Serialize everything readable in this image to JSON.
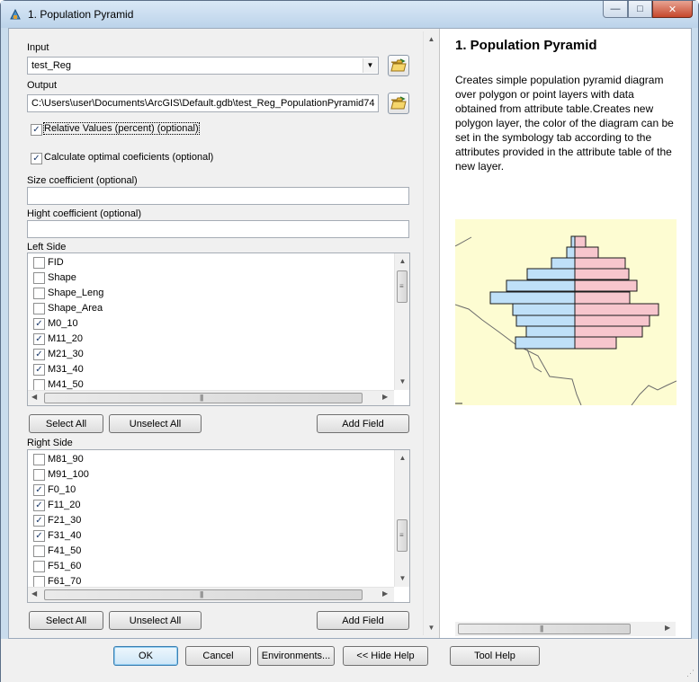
{
  "window": {
    "title": "1. Population Pyramid",
    "controls": {
      "minimize": "—",
      "maximize": "□",
      "close": "✕"
    }
  },
  "form": {
    "input": {
      "label": "Input",
      "value": "test_Reg"
    },
    "output": {
      "label": "Output",
      "value": "C:\\Users\\user\\Documents\\ArcGIS\\Default.gdb\\test_Reg_PopulationPyramid74"
    },
    "relative_values": {
      "label": "Relative Values (percent) (optional)",
      "checked": true
    },
    "calculate_optimal": {
      "label": "Calculate optimal coeficients (optional)",
      "checked": true
    },
    "size_coefficient": {
      "label": "Size coefficient (optional)",
      "value": ""
    },
    "hight_coefficient": {
      "label": "Hight coefficient (optional)",
      "value": ""
    },
    "left_side": {
      "label": "Left Side",
      "items": [
        {
          "label": "FID",
          "checked": false
        },
        {
          "label": "Shape",
          "checked": false
        },
        {
          "label": "Shape_Leng",
          "checked": false
        },
        {
          "label": "Shape_Area",
          "checked": false
        },
        {
          "label": "M0_10",
          "checked": true
        },
        {
          "label": "M11_20",
          "checked": true
        },
        {
          "label": "M21_30",
          "checked": true
        },
        {
          "label": "M31_40",
          "checked": true
        },
        {
          "label": "M41_50",
          "checked": false
        }
      ],
      "select_all": "Select All",
      "unselect_all": "Unselect All",
      "add_field": "Add Field"
    },
    "right_side": {
      "label": "Right Side",
      "items": [
        {
          "label": "M81_90",
          "checked": false
        },
        {
          "label": "M91_100",
          "checked": false
        },
        {
          "label": "F0_10",
          "checked": true
        },
        {
          "label": "F11_20",
          "checked": true
        },
        {
          "label": "F21_30",
          "checked": true
        },
        {
          "label": "F31_40",
          "checked": true
        },
        {
          "label": "F41_50",
          "checked": false
        },
        {
          "label": "F51_60",
          "checked": false
        },
        {
          "label": "F61_70",
          "checked": false
        }
      ],
      "select_all": "Select All",
      "unselect_all": "Unselect All",
      "add_field": "Add Field"
    }
  },
  "help": {
    "title": "1. Population Pyramid",
    "description": "Creates simple population pyramid diagram over polygon or point layers with data obtained from attribute table.Creates new polygon layer, the color of the diagram can be set in the symbology tab according to the attributes provided in the attribute table of the new layer.",
    "colors": {
      "male": "#bfe0f8",
      "female": "#f7c6cd",
      "map_background": "#fdfcd2"
    }
  },
  "buttons": {
    "ok": "OK",
    "cancel": "Cancel",
    "environments": "Environments...",
    "hide_help": "<< Hide Help",
    "tool_help": "Tool Help"
  }
}
